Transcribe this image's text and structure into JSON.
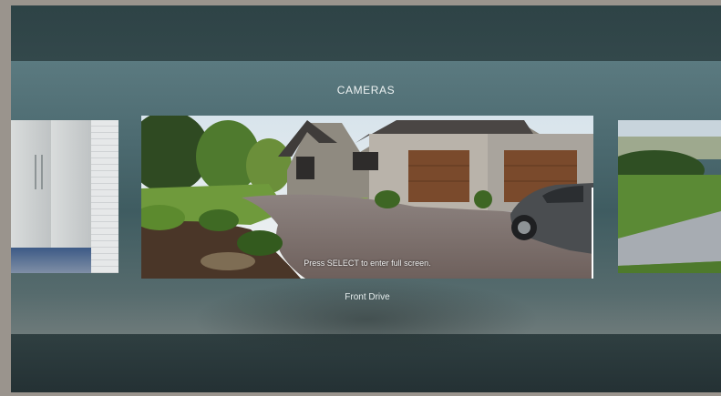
{
  "screen": {
    "title": "CAMERAS"
  },
  "carousel": {
    "selected": {
      "name": "Front Drive",
      "hint": "Press SELECT to enter full screen."
    },
    "tiles": [
      {
        "position": "previous",
        "scene": "garage-cabinets"
      },
      {
        "position": "current",
        "scene": "front-driveway"
      },
      {
        "position": "next",
        "scene": "lawn-walkway"
      }
    ]
  },
  "colors": {
    "panel": "#4c6a70",
    "text": "#eef3f3"
  }
}
